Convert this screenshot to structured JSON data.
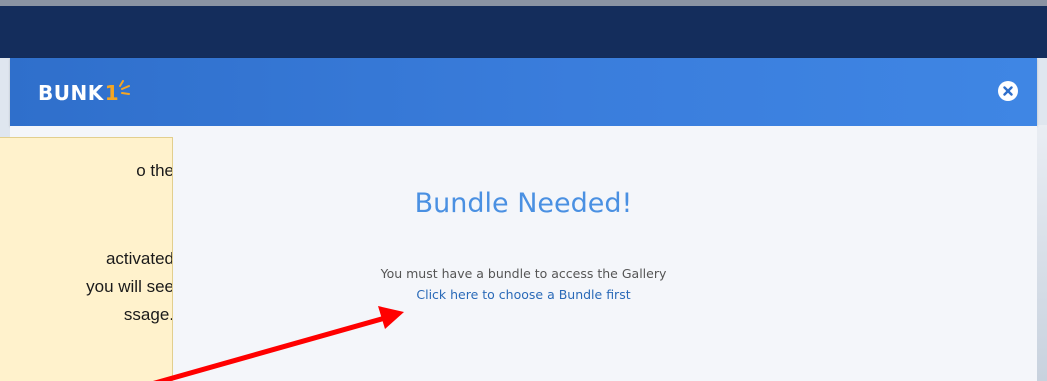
{
  "header": {
    "logo_text": "BUNK",
    "logo_number": "1"
  },
  "modal": {
    "title": "Bundle Needed!",
    "message": "You must have a bundle to access the Gallery",
    "link_label": "Click here to choose a Bundle first"
  },
  "callout": {
    "lines": [
      "o the",
      "activated",
      "you will see",
      "ssage."
    ]
  },
  "colors": {
    "navbar": "#142d5c",
    "modal_header": "#3a7ddc",
    "title": "#4a90e2",
    "link": "#2a6ab8",
    "logo_accent": "#f5a623",
    "callout_bg": "#fff2cc",
    "arrow": "#ff0000"
  }
}
